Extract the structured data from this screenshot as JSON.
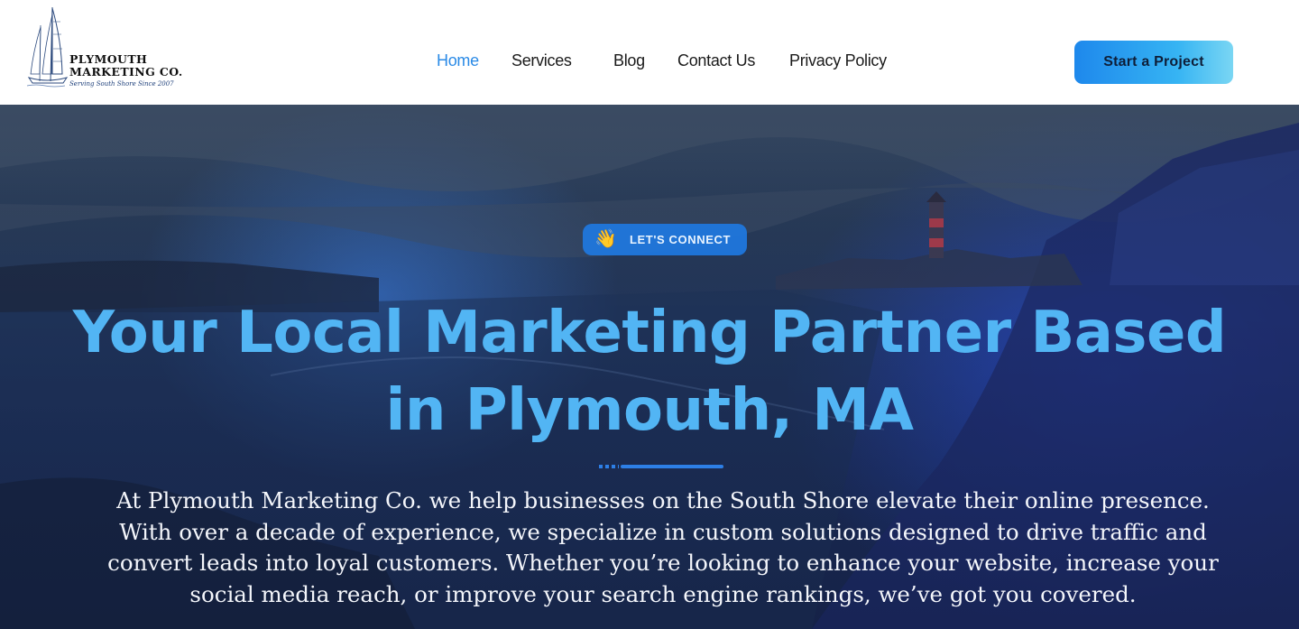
{
  "brand": {
    "name": "PLYMOUTH MARKETING CO.",
    "tagline": "Serving South Shore Since 2007",
    "logo_icon": "sailboat-icon"
  },
  "nav": {
    "items": [
      {
        "label": "Home",
        "active": true
      },
      {
        "label": "Services",
        "active": false
      },
      {
        "label": "Blog",
        "active": false
      },
      {
        "label": "Contact Us",
        "active": false
      },
      {
        "label": "Privacy Policy",
        "active": false
      }
    ],
    "active_color": "#2a8ae6"
  },
  "cta": {
    "label": "Start a Project"
  },
  "hero": {
    "badge": {
      "icon": "waving-hand-icon",
      "label": "LET'S CONNECT"
    },
    "title": "Your Local Marketing Partner Based in Plymouth, MA",
    "description": "At Plymouth Marketing Co. we help businesses on the South Shore elevate their online presence. With over a decade of experience, we specialize in custom solutions designed to drive traffic and convert leads into loyal customers. Whether you’re looking to enhance your website, increase your social media reach, or improve your search engine rankings, we’ve got you covered."
  },
  "colors": {
    "accent": "#2a8ae6",
    "title": "#52b5f4",
    "hero_text": "#f4f6fb"
  }
}
